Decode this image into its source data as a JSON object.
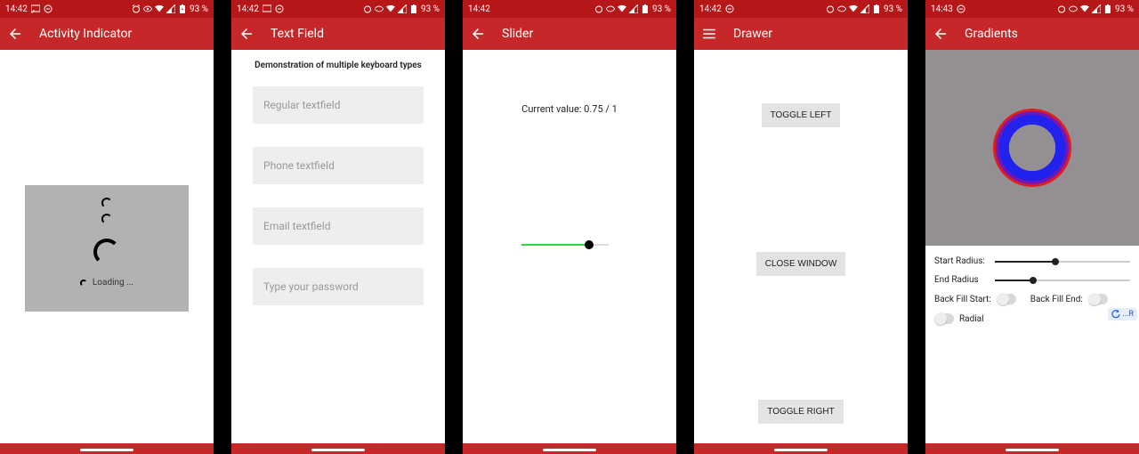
{
  "status": {
    "time_a": "14:42",
    "time_b": "14:43",
    "battery": "93 %"
  },
  "s1": {
    "title": "Activity Indicator",
    "loading": "Loading ..."
  },
  "s2": {
    "title": "Text Field",
    "subtitle": "Demonstration of multiple keyboard types",
    "fields": {
      "regular": "Regular textfield",
      "phone": "Phone textfield",
      "email": "Email textfield",
      "password": "Type your password"
    }
  },
  "s3": {
    "title": "Slider",
    "value_text": "Current value: 0.75 / 1"
  },
  "s4": {
    "title": "Drawer",
    "toggle_left": "TOGGLE LEFT",
    "close": "CLOSE WINDOW",
    "toggle_right": "TOGGLE RIGHT"
  },
  "s5": {
    "title": "Gradients",
    "start_radius": "Start Radius:",
    "end_radius": "End Radius",
    "back_fill_start": "Back Fill Start:",
    "back_fill_end": "Back Fill End:",
    "radial": "Radial",
    "tag": "...R"
  }
}
